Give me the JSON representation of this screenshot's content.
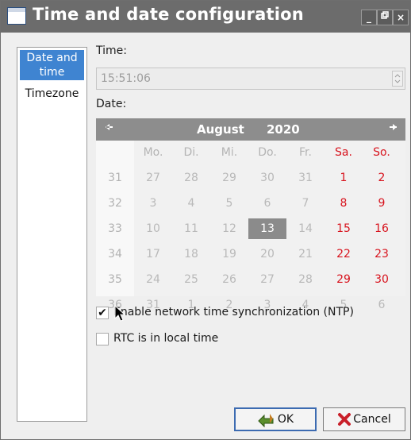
{
  "window": {
    "title": "Time and date configuration",
    "controls": [
      "_",
      "ᴿ",
      "×"
    ]
  },
  "sidebar": {
    "items": [
      {
        "label": "Date and time",
        "selected": true
      },
      {
        "label": "Timezone",
        "selected": false
      }
    ]
  },
  "time": {
    "label": "Time:",
    "value": "15:51:06"
  },
  "date": {
    "label": "Date:"
  },
  "calendar": {
    "month": "August",
    "year": "2020",
    "prev_icon": "left-arrow-icon",
    "next_icon": "right-arrow-icon",
    "weekdays": [
      "Mo.",
      "Di.",
      "Mi.",
      "Do.",
      "Fr.",
      "Sa.",
      "So."
    ],
    "weeks": [
      {
        "wk": "31",
        "days": [
          "27",
          "28",
          "29",
          "30",
          "31",
          "1",
          "2"
        ]
      },
      {
        "wk": "32",
        "days": [
          "3",
          "4",
          "5",
          "6",
          "7",
          "8",
          "9"
        ]
      },
      {
        "wk": "33",
        "days": [
          "10",
          "11",
          "12",
          "13",
          "14",
          "15",
          "16"
        ]
      },
      {
        "wk": "34",
        "days": [
          "17",
          "18",
          "19",
          "20",
          "21",
          "22",
          "23"
        ]
      },
      {
        "wk": "35",
        "days": [
          "24",
          "25",
          "26",
          "27",
          "28",
          "29",
          "30"
        ]
      },
      {
        "wk": "36",
        "days": [
          "31",
          "1",
          "2",
          "3",
          "4",
          "5",
          "6"
        ]
      }
    ],
    "selected_day": "13",
    "weekend_color": "#d8141e"
  },
  "options": {
    "ntp_label": "Enable network time synchronization (NTP)",
    "ntp_checked": true,
    "rtc_label": "RTC is in local time",
    "rtc_checked": false
  },
  "buttons": {
    "ok": "OK",
    "cancel": "Cancel"
  }
}
